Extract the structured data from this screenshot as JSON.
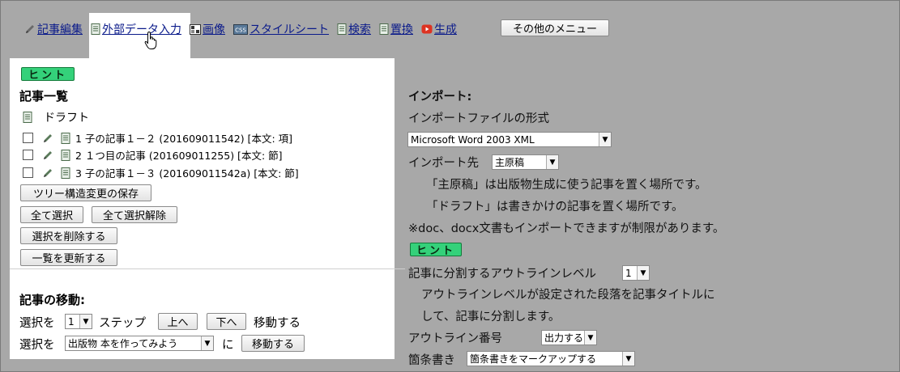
{
  "nav": {
    "items": [
      {
        "label": "記事編集",
        "icon": "pencil-icon"
      },
      {
        "label": "外部データ入力",
        "icon": "document-icon"
      },
      {
        "label": "画像",
        "icon": "image-icon"
      },
      {
        "label": "スタイルシート",
        "icon": "css-icon"
      },
      {
        "label": "検索",
        "icon": "document-icon"
      },
      {
        "label": "置換",
        "icon": "document-icon"
      },
      {
        "label": "生成",
        "icon": "youtube-icon"
      }
    ],
    "more_label": "その他のメニュー"
  },
  "left": {
    "hint_label": "ヒント",
    "article_list_title": "記事一覧",
    "draft_label": "ドラフト",
    "articles": [
      {
        "text": "1 子の記事１－２ (201609011542) [本文: 項]"
      },
      {
        "text": "2 １つ目の記事 (201609011255) [本文: 節]"
      },
      {
        "text": "3 子の記事１－３ (201609011542a) [本文: 節]"
      }
    ],
    "buttons": {
      "save_tree": "ツリー構造変更の保存",
      "select_all": "全て選択",
      "deselect_all": "全て選択解除",
      "delete_selected": "選択を削除する",
      "refresh": "一覧を更新する"
    },
    "move": {
      "title": "記事の移動:",
      "row1_prefix": "選択を",
      "step_value": "1",
      "row1_step": "ステップ",
      "up_button": "上へ",
      "down_button": "下へ",
      "row1_suffix": "移動する",
      "row2_prefix": "選択を",
      "target_value": "出版物 本を作ってみよう",
      "row2_ni": "に",
      "move_button": "移動する"
    }
  },
  "import": {
    "title": "インポート:",
    "format_label": "インポートファイルの形式",
    "format_value": "Microsoft Word 2003 XML",
    "dest_label": "インポート先",
    "dest_value": "主原稿",
    "note1": "「主原稿」は出版物生成に使う記事を置く場所です。",
    "note2": "「ドラフト」は書きかけの記事を置く場所です。",
    "note3": "※doc、docx文書もインポートできますが制限があります。",
    "hint_label": "ヒント",
    "outline_label": "記事に分割するアウトラインレベル",
    "outline_value": "1",
    "outline_desc1": "アウトラインレベルが設定された段落を記事タイトルに",
    "outline_desc2": "して、記事に分割します。",
    "outline_number_label": "アウトライン番号",
    "outline_number_value": "出力する",
    "bullets_label": "箇条書き",
    "bullets_value": "箇条書きをマークアップする"
  },
  "colors": {
    "background": "#a8a8a8",
    "hint": "#34d17a",
    "link": "#0a1a8a"
  }
}
